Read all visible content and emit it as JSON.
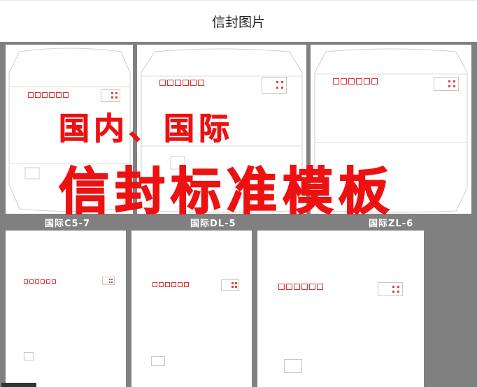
{
  "page": {
    "title": "信封图片"
  },
  "envelopes": [
    {
      "label": "国际C5-7"
    },
    {
      "label": "国际DL-5"
    },
    {
      "label": "国际ZL-6"
    }
  ],
  "overlay": {
    "line1": "国内、国际",
    "line2": "信封标准模板"
  },
  "colors": {
    "accent": "#ee1111",
    "board": "#808080",
    "stamp_box": "#e03030"
  }
}
